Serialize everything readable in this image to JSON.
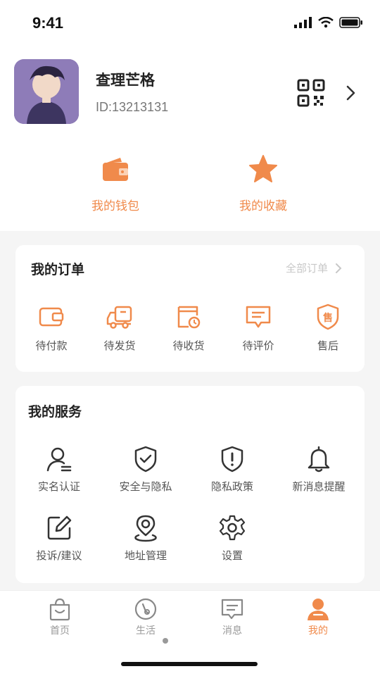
{
  "status_bar": {
    "time": "9:41"
  },
  "profile": {
    "name": "查理芒格",
    "id": "ID:13213131"
  },
  "quick_actions": [
    {
      "label": "我的钱包",
      "icon": "wallet-icon"
    },
    {
      "label": "我的收藏",
      "icon": "star-icon"
    }
  ],
  "orders": {
    "title": "我的订单",
    "all_label": "全部订单",
    "items": [
      {
        "label": "待付款",
        "icon": "wallet-icon"
      },
      {
        "label": "待发货",
        "icon": "delivery-truck-icon"
      },
      {
        "label": "待收货",
        "icon": "receipt-clock-icon"
      },
      {
        "label": "待评价",
        "icon": "comment-icon"
      },
      {
        "label": "售后",
        "icon": "aftersale-shield-icon"
      }
    ]
  },
  "services": {
    "title": "我的服务",
    "items": [
      {
        "label": "实名认证",
        "icon": "user-verify-icon"
      },
      {
        "label": "安全与隐私",
        "icon": "shield-check-icon"
      },
      {
        "label": "隐私政策",
        "icon": "shield-alert-icon"
      },
      {
        "label": "新消息提醒",
        "icon": "bell-icon"
      },
      {
        "label": "投诉/建议",
        "icon": "edit-icon"
      },
      {
        "label": "地址管理",
        "icon": "location-icon"
      },
      {
        "label": "设置",
        "icon": "gear-icon"
      }
    ]
  },
  "tabbar": {
    "items": [
      {
        "label": "首页",
        "icon": "home-bag-icon"
      },
      {
        "label": "生活",
        "icon": "life-icon"
      },
      {
        "label": "消息",
        "icon": "message-icon"
      },
      {
        "label": "我的",
        "icon": "user-icon"
      }
    ],
    "active": "我的"
  },
  "colors": {
    "accent": "#f08a4b",
    "background": "#f5f5f5"
  }
}
